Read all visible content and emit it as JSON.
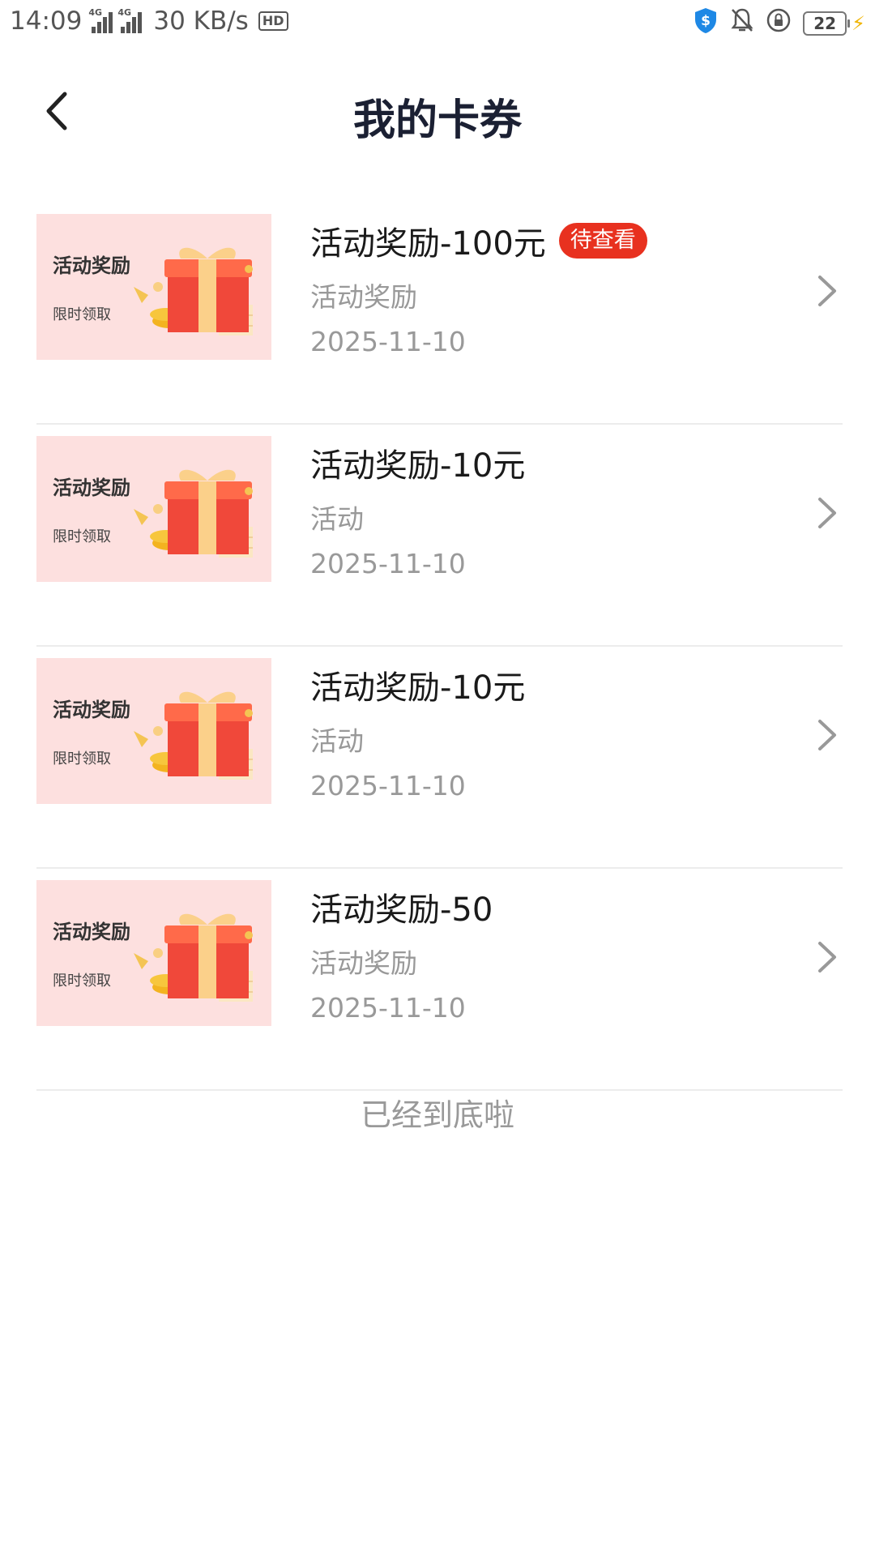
{
  "status": {
    "time": "14:09",
    "net1": "4G",
    "net2": "4G",
    "speed": "30 KB/s",
    "hd": "HD",
    "battery": "22"
  },
  "header": {
    "title": "我的卡券"
  },
  "items": [
    {
      "thumb_title": "活动奖励",
      "thumb_sub": "限时领取",
      "name": "活动奖励-100元",
      "badge": "待查看",
      "category": "活动奖励",
      "date": "2025-11-10"
    },
    {
      "thumb_title": "活动奖励",
      "thumb_sub": "限时领取",
      "name": "活动奖励-10元",
      "badge": "",
      "category": "活动",
      "date": "2025-11-10"
    },
    {
      "thumb_title": "活动奖励",
      "thumb_sub": "限时领取",
      "name": "活动奖励-10元",
      "badge": "",
      "category": "活动",
      "date": "2025-11-10"
    },
    {
      "thumb_title": "活动奖励",
      "thumb_sub": "限时领取",
      "name": "活动奖励-50",
      "badge": "",
      "category": "活动奖励",
      "date": "2025-11-10"
    }
  ],
  "footer": {
    "end_text": "已经到底啦"
  },
  "colors": {
    "badge": "#e8311f",
    "thumb_bg": "#fde0df",
    "title": "#1b2033"
  }
}
